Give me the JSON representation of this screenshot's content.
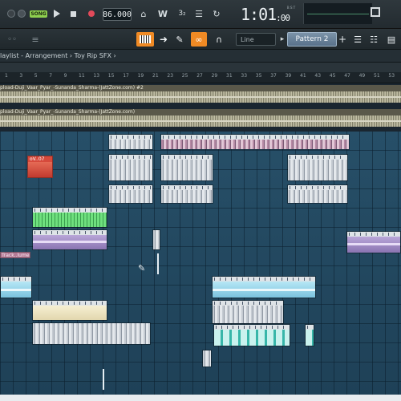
{
  "transport": {
    "song_mode": "SONG",
    "tempo": "86.000",
    "time": "1:01",
    "time_sub": ":00",
    "time_unit": "B:S:T"
  },
  "toolbar": {
    "snap": "Line",
    "pattern": "Pattern 2"
  },
  "playlist": {
    "title": "laylist - Arrangement  ›  Toy Rip SFX  ›"
  },
  "ruler": {
    "ticks": [
      "1",
      "3",
      "5",
      "7",
      "9",
      "11",
      "13",
      "15",
      "17",
      "19",
      "21",
      "23",
      "25",
      "27",
      "29",
      "31",
      "33",
      "35",
      "37",
      "39",
      "41",
      "43",
      "45",
      "47",
      "49",
      "51",
      "53"
    ]
  },
  "audio_tracks": [
    {
      "label": "pload-Duji_Vaar_Pyar_-Sunanda_Sharma-(JattZone.com) #2"
    },
    {
      "label": "pload-Duji_Vaar_Pyar_-Sunanda_Sharma-(JattZone.com)"
    }
  ],
  "clips": {
    "red_clip_label": "oV..07",
    "track_clip_label": "Track..lume"
  },
  "colors": {
    "grid_bg": "#29536d",
    "accent_orange": "#f08a24",
    "song_led": "#8fd14f",
    "record_red": "#e34a5a"
  }
}
